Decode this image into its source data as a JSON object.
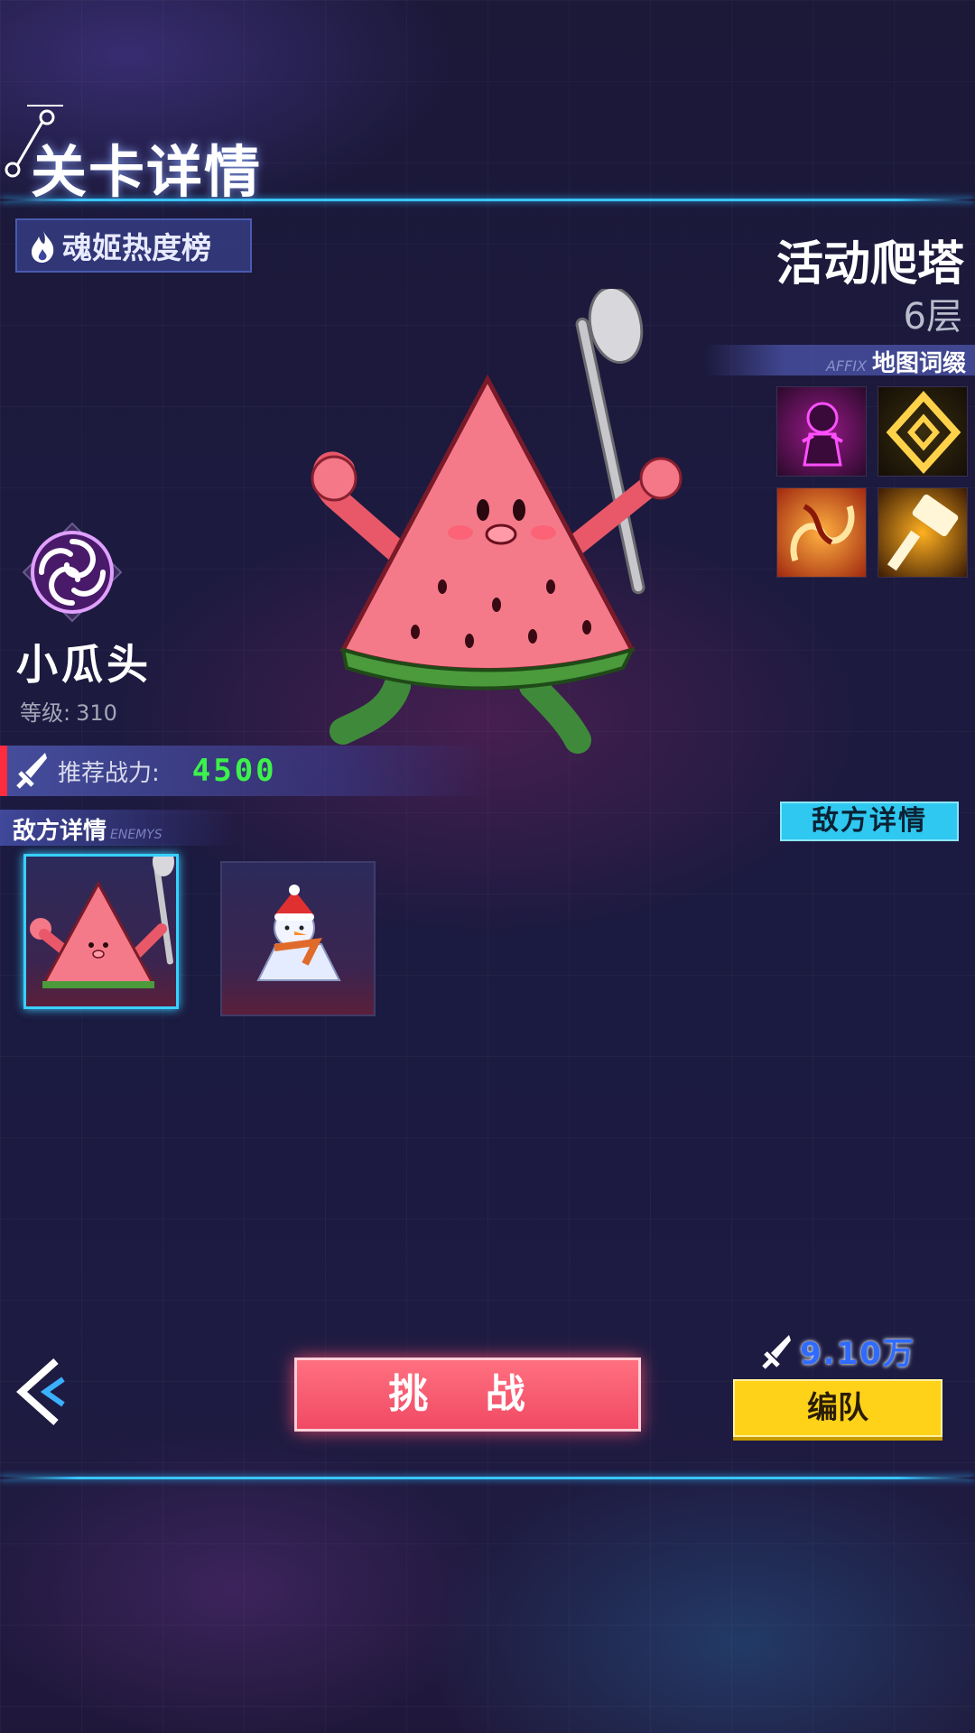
{
  "header": {
    "title": "关卡详情"
  },
  "hot_rank": {
    "label": "魂姬热度榜",
    "icon": "flame-icon"
  },
  "stage": {
    "name": "活动爬塔",
    "floor": "6层"
  },
  "affix": {
    "title_en": "AFFIX",
    "title_cn": "地图词缀",
    "icons": [
      "shadow-figure-icon",
      "golden-diamond-icon",
      "fire-swirl-icon",
      "hammer-icon"
    ]
  },
  "character": {
    "name": "小瓜头",
    "level_label": "等级:",
    "level_value": "310",
    "emblem": "spiral-emblem-icon"
  },
  "power": {
    "label": "推荐战力:",
    "value": "4500"
  },
  "enemies": {
    "title_cn": "敌方详情",
    "title_en": "ENEMYS",
    "detail_button": "敌方详情",
    "list": [
      {
        "name": "watermelon",
        "selected": true
      },
      {
        "name": "snowman",
        "selected": false
      }
    ]
  },
  "actions": {
    "challenge": "挑 战",
    "team": "编队",
    "team_power": "9.10万"
  },
  "colors": {
    "accent_cyan": "#39c6ff",
    "challenge_red": "#f04a64",
    "team_yellow": "#ffd21a",
    "power_green": "#3cf24b"
  }
}
